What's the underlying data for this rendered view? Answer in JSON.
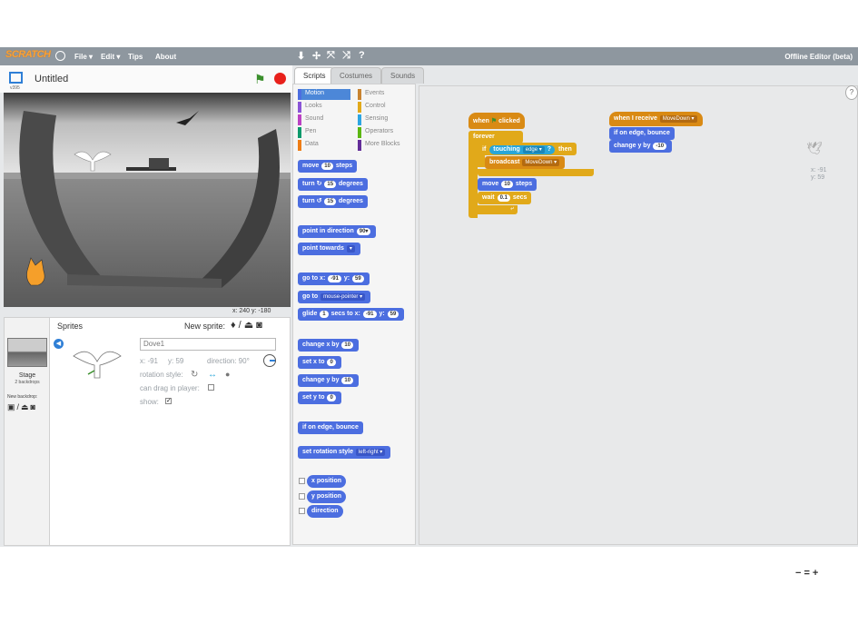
{
  "menubar": {
    "logo": "SCRATCH",
    "menus": [
      "File ▾",
      "Edit ▾",
      "Tips",
      "About"
    ],
    "tools": [
      "⬇",
      "✢",
      "⤧",
      "⤨",
      "?"
    ],
    "editor_label": "Offline Editor (beta)"
  },
  "stage_header": {
    "version": "v395",
    "project_title": "Untitled"
  },
  "stage": {
    "coords": "x: 240  y: -180"
  },
  "sprites_pane": {
    "title": "Sprites",
    "new_sprite_label": "New sprite:",
    "stage_label": "Stage",
    "stage_sub": "2 backdrops",
    "new_backdrop_label": "New backdrop:",
    "sprite_name": "Dove1",
    "x_label": "x: -91",
    "y_label": "y: 59",
    "direction_label": "direction: 90°",
    "rotation_style_label": "rotation style:",
    "drag_label": "can drag in player:",
    "show_label": "show:"
  },
  "tabs": [
    "Scripts",
    "Costumes",
    "Sounds"
  ],
  "categories": [
    {
      "label": "Motion",
      "color": "#4c6ee0"
    },
    {
      "label": "Looks",
      "color": "#8a55d7"
    },
    {
      "label": "Sound",
      "color": "#bb42c3"
    },
    {
      "label": "Pen",
      "color": "#0e9a6c"
    },
    {
      "label": "Data",
      "color": "#ee7d16"
    },
    {
      "label": "Events",
      "color": "#c88330"
    },
    {
      "label": "Control",
      "color": "#e1a91a"
    },
    {
      "label": "Sensing",
      "color": "#2ca5e2"
    },
    {
      "label": "Operators",
      "color": "#5cb712"
    },
    {
      "label": "More Blocks",
      "color": "#632d99"
    }
  ],
  "palette_blocks": {
    "move": [
      "move",
      "10",
      "steps"
    ],
    "turn_cw": [
      "turn",
      "↻",
      "15",
      "degrees"
    ],
    "turn_ccw": [
      "turn",
      "↺",
      "15",
      "degrees"
    ],
    "point_dir": [
      "point in direction",
      "90▾"
    ],
    "point_towards": [
      "point towards",
      "▾"
    ],
    "goto_xy": [
      "go to x:",
      "-91",
      "y:",
      "59"
    ],
    "goto": [
      "go to",
      "mouse-pointer ▾"
    ],
    "glide": [
      "glide",
      "1",
      "secs to x:",
      "-91",
      "y:",
      "59"
    ],
    "change_x": [
      "change x by",
      "10"
    ],
    "set_x": [
      "set x to",
      "0"
    ],
    "change_y": [
      "change y by",
      "10"
    ],
    "set_y": [
      "set y to",
      "0"
    ],
    "edge": "if on edge, bounce",
    "rot_style": [
      "set rotation style",
      "left-right ▾"
    ],
    "x_pos": "x position",
    "y_pos": "y position",
    "direction": "direction"
  },
  "scripts": {
    "when_flag": [
      "when",
      "clicked"
    ],
    "forever": "forever",
    "if": "if",
    "touching": [
      "touching",
      "edge ▾",
      "?"
    ],
    "then": "then",
    "broadcast": [
      "broadcast",
      "MoveDown ▾"
    ],
    "move": [
      "move",
      "10",
      "steps"
    ],
    "wait": [
      "wait",
      "0.1",
      "secs"
    ],
    "when_receive": [
      "when I receive",
      "MoveDown ▾"
    ],
    "edge": "if on edge, bounce",
    "change_y": [
      "change y by",
      "-10"
    ],
    "ghost_coords": [
      "x: -91",
      "y: 59"
    ]
  },
  "zoom_controls": [
    "−",
    "=",
    "+"
  ]
}
